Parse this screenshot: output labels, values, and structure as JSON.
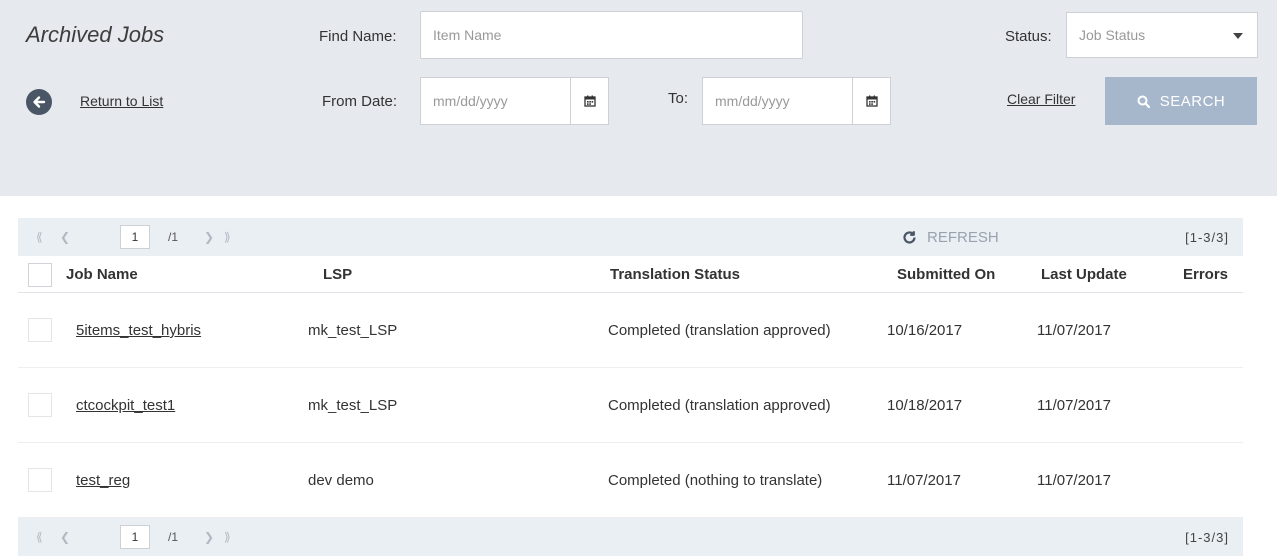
{
  "filters": {
    "title": "Archived Jobs",
    "find_name_label": "Find Name:",
    "find_name_placeholder": "Item Name",
    "status_label": "Status:",
    "status_value": "Job Status",
    "return_label": "Return to List",
    "from_label": "From Date:",
    "from_placeholder": "mm/dd/yyyy",
    "to_label": "To:",
    "to_placeholder": "mm/dd/yyyy",
    "clear_label": "Clear Filter",
    "search_label": "SEARCH"
  },
  "pager": {
    "current_page": "1",
    "total_pages": "/1",
    "refresh_label": "REFRESH",
    "range": "[1-3/3]"
  },
  "columns": {
    "job_name": "Job Name",
    "lsp": "LSP",
    "translation_status": "Translation Status",
    "submitted_on": "Submitted On",
    "last_update": "Last Update",
    "errors": "Errors"
  },
  "rows": [
    {
      "job_name": "5items_test_hybris",
      "lsp": "mk_test_LSP",
      "status": "Completed (translation approved)",
      "submitted": "10/16/2017",
      "updated": "11/07/2017",
      "errors": ""
    },
    {
      "job_name": "ctcockpit_test1",
      "lsp": "mk_test_LSP",
      "status": "Completed (translation approved)",
      "submitted": "10/18/2017",
      "updated": "11/07/2017",
      "errors": ""
    },
    {
      "job_name": "test_reg",
      "lsp": "dev demo",
      "status": "Completed (nothing to translate)",
      "submitted": "11/07/2017",
      "updated": "11/07/2017",
      "errors": ""
    }
  ],
  "colors": {
    "panel_bg": "#e6e9ee",
    "search_button": "#a6b7cc",
    "pager_bg": "#eaeff4"
  }
}
